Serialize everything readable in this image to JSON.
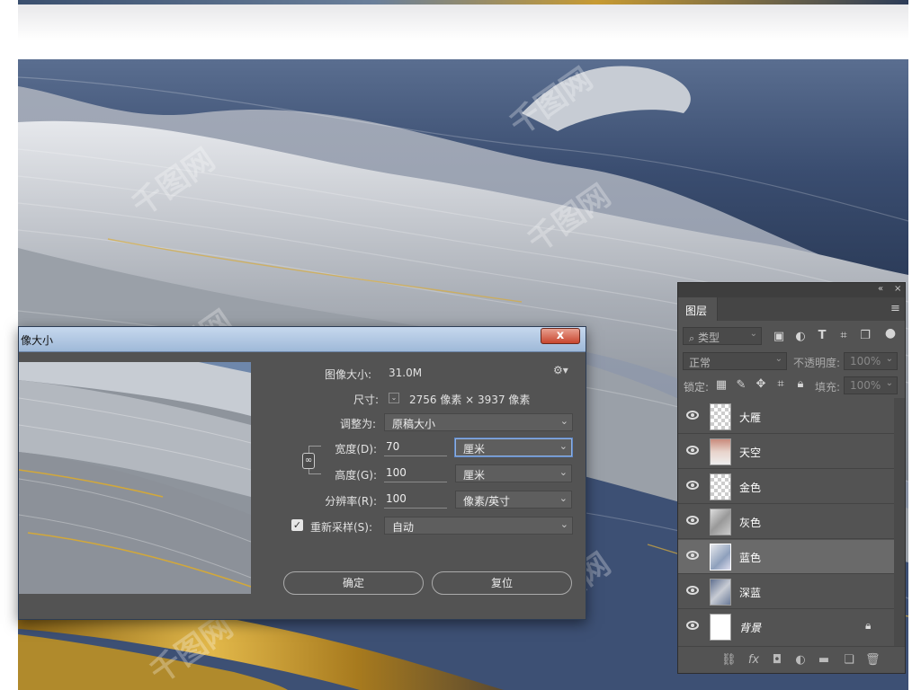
{
  "watermark": "千图网",
  "dialog": {
    "title": "像大小",
    "close_label": "x",
    "image_size_label": "图像大小:",
    "image_size_value": "31.0M",
    "dimensions_label": "尺寸:",
    "dimensions_value": "2756 像素 × 3937 像素",
    "fit_label": "调整为:",
    "fit_value": "原稿大小",
    "width_label": "宽度(D):",
    "width_value": "70",
    "width_unit": "厘米",
    "height_label": "高度(G):",
    "height_value": "100",
    "height_unit": "厘米",
    "resolution_label": "分辨率(R):",
    "resolution_value": "100",
    "resolution_unit": "像素/英寸",
    "resample_label": "重新采样(S):",
    "resample_value": "自动",
    "ok_label": "确定",
    "reset_label": "复位"
  },
  "layers_panel": {
    "tab_label": "图层",
    "filter_placeholder": "类型",
    "blend_mode": "正常",
    "opacity_label": "不透明度:",
    "opacity_value": "100%",
    "lock_label": "锁定:",
    "fill_label": "填充:",
    "fill_value": "100%",
    "layers": [
      {
        "name": "大雁",
        "selected": false,
        "locked": false
      },
      {
        "name": "天空",
        "selected": false,
        "locked": false
      },
      {
        "name": "金色",
        "selected": false,
        "locked": false
      },
      {
        "name": "灰色",
        "selected": false,
        "locked": false
      },
      {
        "name": "蓝色",
        "selected": true,
        "locked": false
      },
      {
        "name": "深蓝",
        "selected": false,
        "locked": false
      },
      {
        "name": "背景",
        "selected": false,
        "locked": true
      }
    ]
  },
  "colors": {
    "panel_bg": "#535353",
    "title_blue": "#b3c9e5",
    "close_red": "#c8462e",
    "fabric_blue": "#3f5478",
    "fabric_gold": "#c79a32"
  }
}
